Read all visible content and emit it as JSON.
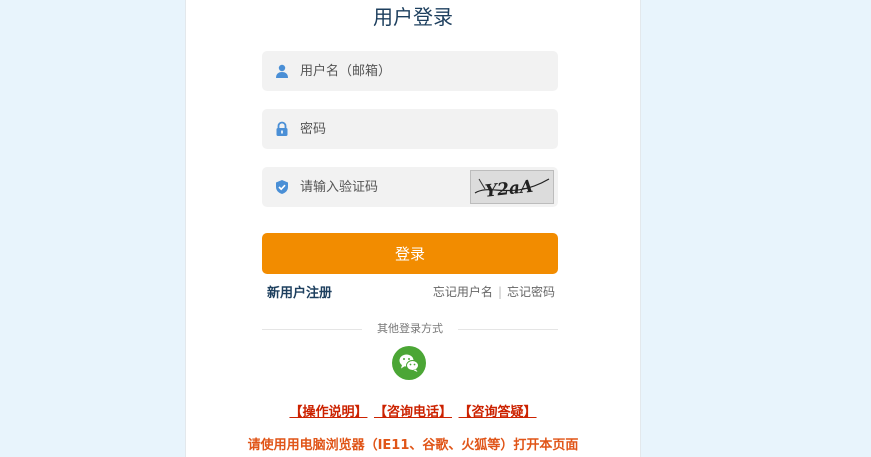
{
  "login": {
    "title": "用户登录",
    "username_placeholder": "用户名（邮箱）",
    "password_placeholder": "密码",
    "captcha_placeholder": "请输入验证码",
    "captcha_text": "Y2aA",
    "login_label": "登录",
    "register_label": "新用户注册",
    "forgot_username_label": "忘记用户名",
    "forgot_password_label": "忘记密码",
    "other_methods_label": "其他登录方式"
  },
  "help_links": [
    "【操作说明】",
    "【咨询电话】",
    "【咨询答疑】"
  ],
  "notice": "请使用用电脑浏览器（IE11、谷歌、火狐等）打开本页面",
  "colors": {
    "background": "#e8f4fc",
    "title": "#1d3f5e",
    "login_button": "#f28c00",
    "icon_blue": "#4a8fd6",
    "wechat_green": "#4ba635",
    "help_link": "#cc2200",
    "notice": "#e05518"
  },
  "icons": {
    "username": "user-icon",
    "password": "lock-icon",
    "captcha": "shield-check-icon",
    "wechat": "wechat-icon"
  }
}
